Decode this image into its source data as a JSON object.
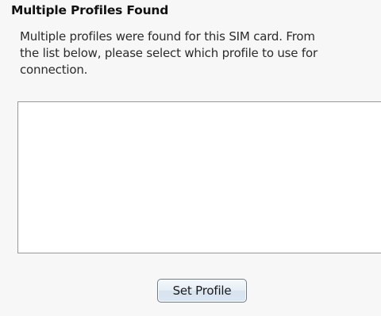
{
  "dialog": {
    "title": "Multiple Profiles Found",
    "message_lines": [
      "Multiple profiles were found for this SIM card. From",
      "the list below, please select which profile to use for",
      "connection."
    ],
    "profiles": [],
    "set_profile_label": "Set Profile"
  }
}
